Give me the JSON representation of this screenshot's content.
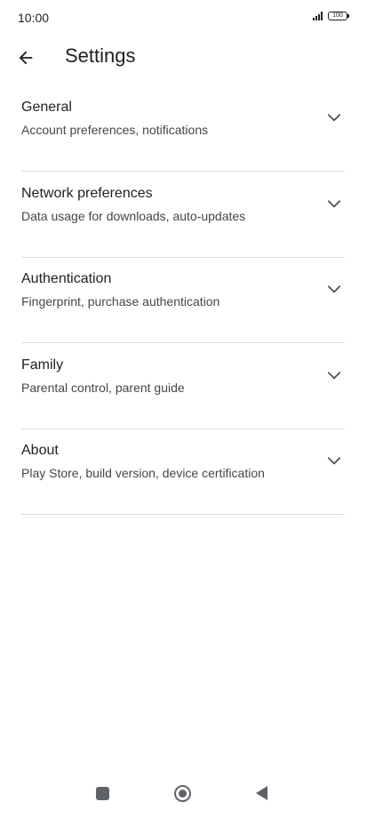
{
  "status_bar": {
    "time": "10:00",
    "battery": "100"
  },
  "header": {
    "title": "Settings",
    "back_icon": "arrow-left-icon"
  },
  "settings": [
    {
      "title": "General",
      "subtitle": "Account preferences, notifications"
    },
    {
      "title": "Network preferences",
      "subtitle": "Data usage for downloads, auto-updates"
    },
    {
      "title": "Authentication",
      "subtitle": "Fingerprint, purchase authentication"
    },
    {
      "title": "Family",
      "subtitle": "Parental control, parent guide"
    },
    {
      "title": "About",
      "subtitle": "Play Store, build version, device certification"
    }
  ],
  "colors": {
    "text_primary": "#202124",
    "text_secondary": "#444746",
    "divider": "#dadce0",
    "nav_icons": "#5f6368"
  }
}
